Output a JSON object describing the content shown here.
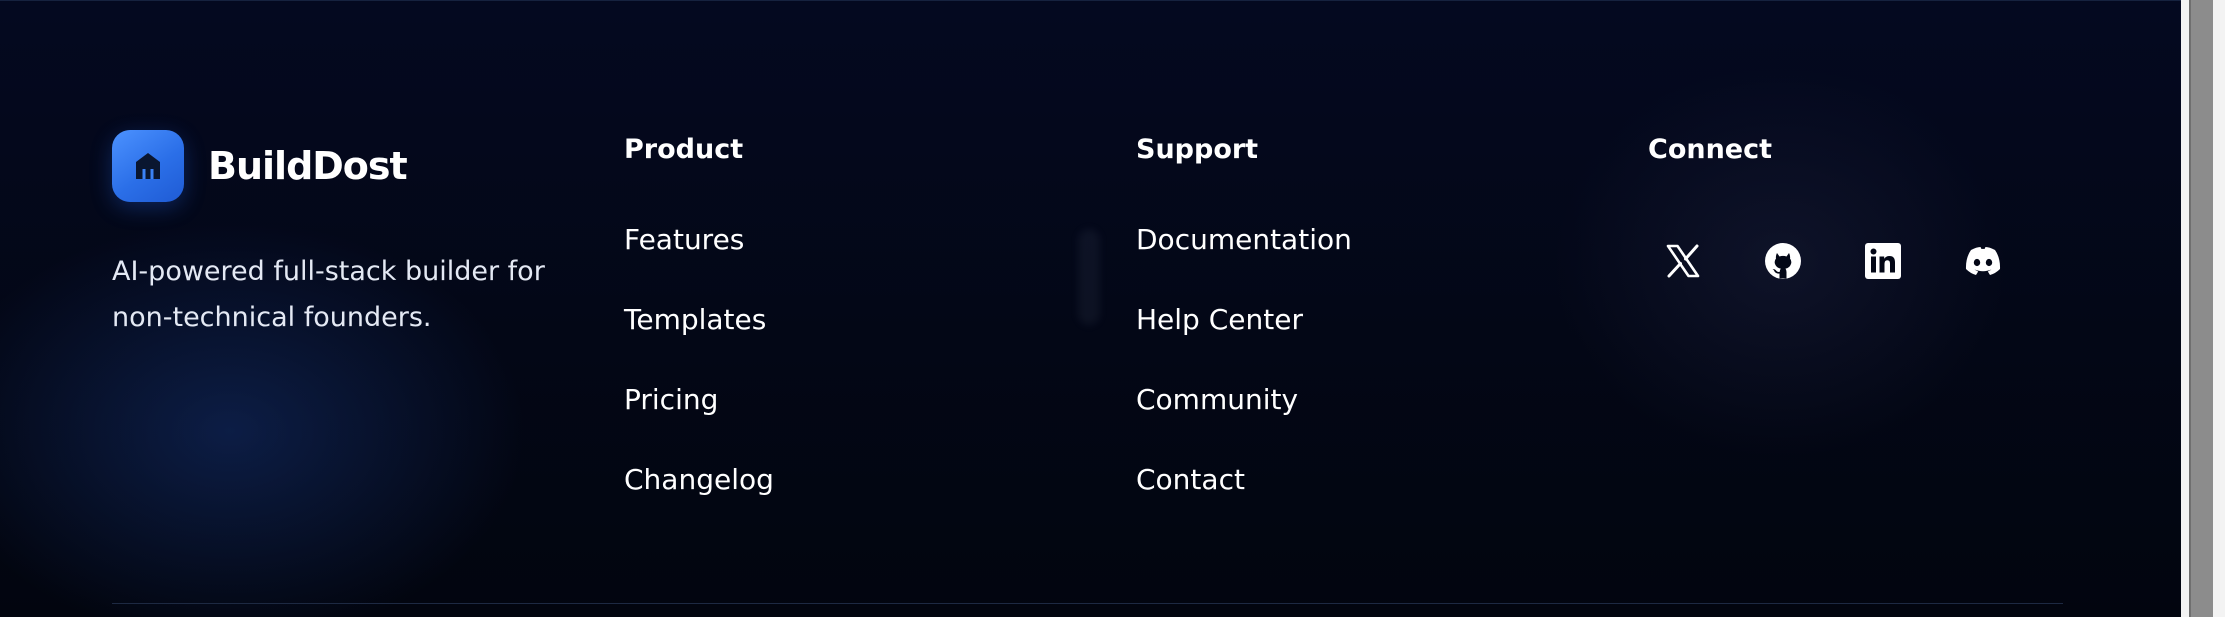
{
  "brand": {
    "name": "BuildDost",
    "tagline": "AI-powered full-stack builder for non-technical founders."
  },
  "columns": [
    {
      "title": "Product",
      "links": [
        "Features",
        "Templates",
        "Pricing",
        "Changelog"
      ]
    },
    {
      "title": "Support",
      "links": [
        "Documentation",
        "Help Center",
        "Community",
        "Contact"
      ]
    },
    {
      "title": "Connect"
    }
  ],
  "socials": [
    {
      "icon": "x-icon",
      "label": "X"
    },
    {
      "icon": "github-icon",
      "label": "GitHub"
    },
    {
      "icon": "linkedin-icon",
      "label": "LinkedIn"
    },
    {
      "icon": "discord-icon",
      "label": "Discord"
    }
  ],
  "colors": {
    "background": "#030716",
    "brand_accent": "#3b82f6",
    "text": "#ffffff",
    "divider": "#1d2942"
  }
}
